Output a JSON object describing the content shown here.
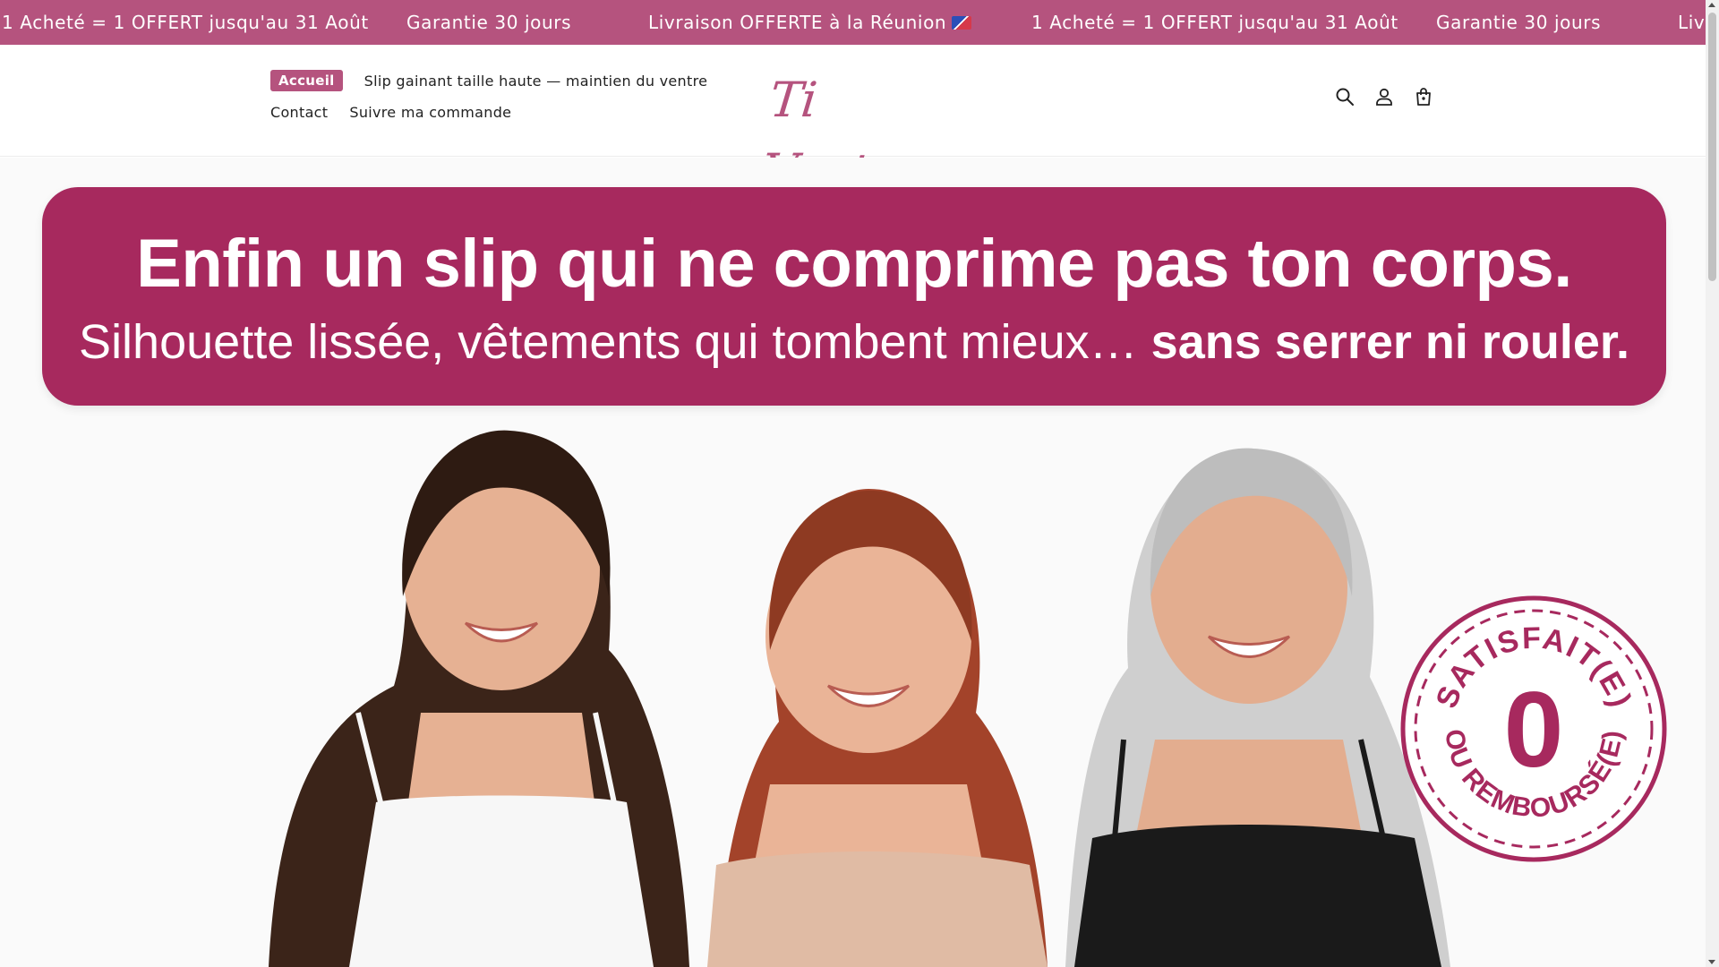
{
  "announcement": {
    "items": [
      "1 Acheté = 1 OFFERT jusqu'au 31 Août",
      "Garantie 30 jours",
      "Livraison OFFERTE à la Réunion",
      "1 Acheté = 1 OFFERT jusqu'au 31 Août",
      "Garantie 30 jours",
      "Livr"
    ],
    "flag_icon": "reunion-flag-icon",
    "background": "#b5537e"
  },
  "header": {
    "nav": {
      "home": "Accueil",
      "product": "Slip gainant taille haute — maintien du ventre",
      "contact": "Contact",
      "track_order": "Suivre ma commande"
    },
    "logo_text": "Ti Ventre",
    "icons": [
      "search-icon",
      "account-icon",
      "cart-icon"
    ]
  },
  "hero": {
    "banner_title": "Enfin un slip qui ne comprime pas ton corps.",
    "banner_sub_regular": "Silhouette lissée, vêtements qui tombent mieux…",
    "banner_sub_bold": "sans serrer ni rouler.",
    "stamp": {
      "top_text": "SATISFAIT(E)",
      "center": "0",
      "bottom_text": "OU REMBOURSÉ(E)"
    }
  },
  "colors": {
    "brand": "#b5537e",
    "banner": "#a7295e"
  }
}
